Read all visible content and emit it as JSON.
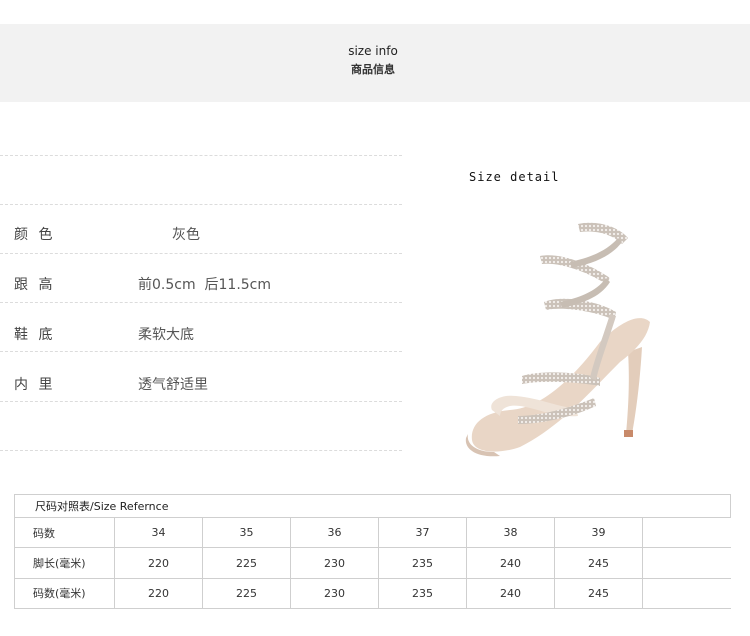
{
  "header": {
    "title": "size info",
    "subtitle": "商品信息"
  },
  "specs": [
    {
      "label": "颜 色",
      "value": "灰色"
    },
    {
      "label": "跟 高",
      "value": "前0.5cm  后11.5cm"
    },
    {
      "label": "鞋 底",
      "value": "柔软大底"
    },
    {
      "label": "内 里",
      "value": "透气舒适里"
    }
  ],
  "detail": {
    "label": "Size detail"
  },
  "size_table": {
    "caption": "尺码对照表/Size Refernce",
    "rows": [
      {
        "head": "码数",
        "cells": [
          "34",
          "35",
          "36",
          "37",
          "38",
          "39"
        ]
      },
      {
        "head": "脚长(毫米)",
        "cells": [
          "220",
          "225",
          "230",
          "235",
          "240",
          "245"
        ]
      },
      {
        "head": "码数(毫米)",
        "cells": [
          "220",
          "225",
          "230",
          "235",
          "240",
          "245"
        ]
      }
    ]
  },
  "colors": {
    "band": "#f2f2f2",
    "strap": "#c9bfb6",
    "sole": "#e8d4c4"
  }
}
